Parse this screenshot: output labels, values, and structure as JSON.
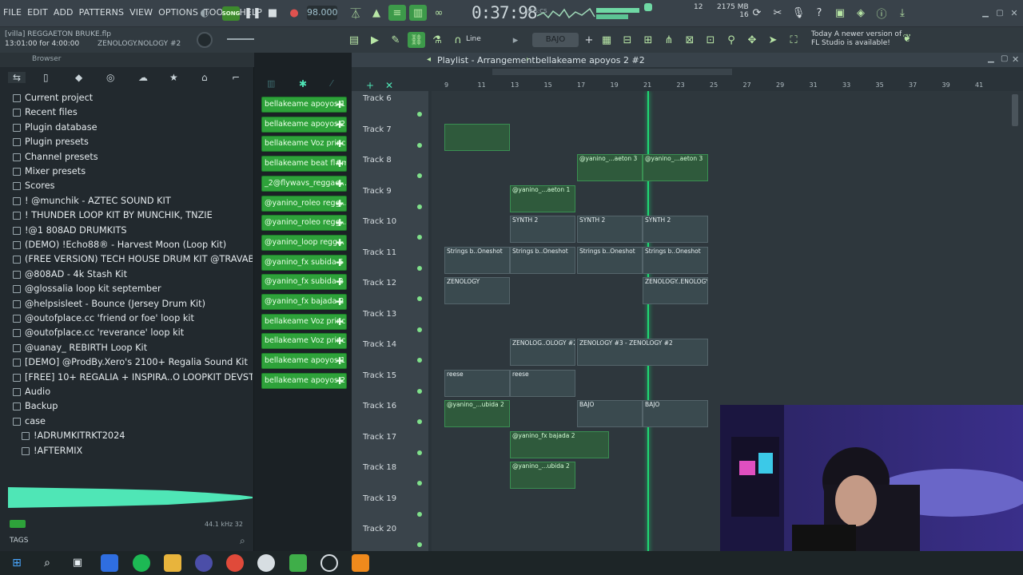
{
  "menu": [
    "FILE",
    "EDIT",
    "ADD",
    "PATTERNS",
    "VIEW",
    "OPTIONS",
    "TOOLS",
    "HELP"
  ],
  "transport": {
    "mode": "SONG",
    "bpm": "98.000",
    "time": "0:37:98",
    "time_sub": "M:S:CS",
    "cpu": "12",
    "mem": "2175 MB",
    "mem2": "16"
  },
  "project": {
    "name": "[villa] REGGAETON BRUKE.flp",
    "time": "13:01:00 for 4:00:00",
    "pattern": "ZENOLOGY.NOLOGY #2"
  },
  "toolbar2": {
    "snap_mode": "Line",
    "snap": "BAJO"
  },
  "news": {
    "line1": "Today A newer version of",
    "line2": "FL Studio is available!"
  },
  "browser": {
    "title": "Browser",
    "items": [
      "Current project",
      "Recent files",
      "Plugin database",
      "Plugin presets",
      "Channel presets",
      "Mixer presets",
      "Scores",
      "! @munchik - AZTEC SOUND KIT",
      "! THUNDER LOOP KIT BY MUNCHIK, TNZIE",
      "!@1 808AD DRUMKITS",
      "(DEMO) !Echo88® - Harvest Moon (Loop Kit)",
      "(FREE VERSION) TECH HOUSE DRUM KIT @TRAVABEATS",
      "@808AD - 4k Stash Kit",
      "@glossalia loop kit september",
      "@helpsisleet - Bounce (Jersey Drum Kit)",
      "@outofplace.cc 'friend or foe' loop kit",
      "@outofplace.cc 'reverance' loop kit",
      "@uanay_ REBIRTH Loop Kit",
      "[DEMO] @ProdBy.Xero's 2100+ Regalia Sound Kit",
      "[FREE] 10+ REGALIA + INSPIRA..O LOOPKIT DEVSTACKS @OXYCXDE",
      "Audio",
      "Backup",
      "case"
    ],
    "sub_items": [
      "!ADRUMKITRKT2024",
      "!AFTERMIX"
    ],
    "sample_info": "44.1 kHz 32",
    "tags": "TAGS"
  },
  "patterns": [
    "bellakeame apoyos 1",
    "bellakeame apoyos 2",
    "bellakeame Voz princ...",
    "bellakeame beat fl#m...",
    "_2@flywavs_reggae...",
    "@yanino_roleo regg...",
    "@yanino_roleo regg...",
    "@yanino_loop regg...",
    "@yanino_fx subida 5",
    "@yanino_fx subida 2",
    "@yanino_fx bajada 2",
    "bellakeame Voz princ...",
    "bellakeame Voz princ...",
    "bellakeame apoyos 1...",
    "bellakeame apoyos 2..."
  ],
  "playlist": {
    "title": "Playlist - Arrangement",
    "pattern": "bellakeame apoyos 2 #2",
    "ruler": [
      "9",
      "11",
      "13",
      "15",
      "17",
      "19",
      "21",
      "23",
      "25",
      "27",
      "29",
      "31",
      "33",
      "35",
      "37",
      "39",
      "41"
    ],
    "tracks": [
      "Track 6",
      "Track 7",
      "Track 8",
      "Track 9",
      "Track 10",
      "Track 11",
      "Track 12",
      "Track 13",
      "Track 14",
      "Track 15",
      "Track 16",
      "Track 17",
      "Track 18",
      "Track 19",
      "Track 20"
    ],
    "clips": {
      "t8a": "@yanino_...aeton 3",
      "t8b": "@yanino_...aeton 3",
      "t9": "@yanino_...aeton 1",
      "t10a": "SYNTH 2",
      "t10b": "SYNTH 2",
      "t10c": "SYNTH 2",
      "t11a": "Strings b..Oneshot",
      "t11b": "Strings b..Oneshot",
      "t11c": "Strings b..Oneshot",
      "t11d": "Strings b..Oneshot",
      "t12a": "ZENOLOGY",
      "t12b": "ZENOLOGY..ENOLOGY",
      "t14a": "ZENOLOG..OLOGY #2",
      "t14b": "ZENOLOGY #3 - ZENOLOGY #2",
      "t15a": "reese",
      "t15b": "reese",
      "t16a": "@yanino_...ubida 2",
      "t16b": "BAJO",
      "t16c": "BAJO",
      "t17": "@yanino_fx bajada 2",
      "t18": "@yanino_...ubida 2"
    }
  },
  "colors": {
    "accent": "#2ea23a",
    "playhead": "#1fd873",
    "topbar": "#39424a"
  }
}
